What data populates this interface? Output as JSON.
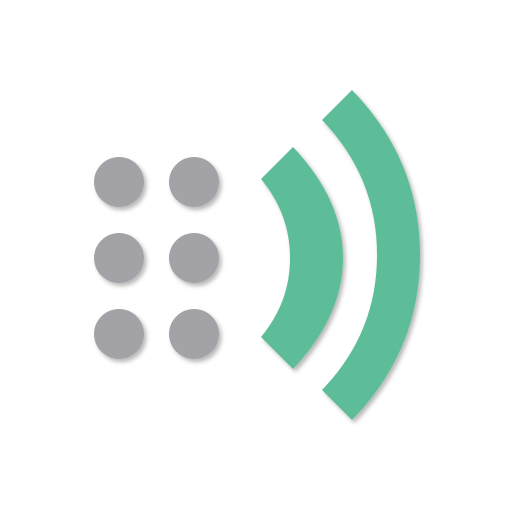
{
  "icon": {
    "name": "braille-signal-logo",
    "dots": 6,
    "arcs": 2,
    "colors": {
      "background": "#ffffff",
      "dot_fill": "#a3a3a7",
      "arc_fill": "#5dbd98",
      "shadow": "#00000033"
    }
  }
}
